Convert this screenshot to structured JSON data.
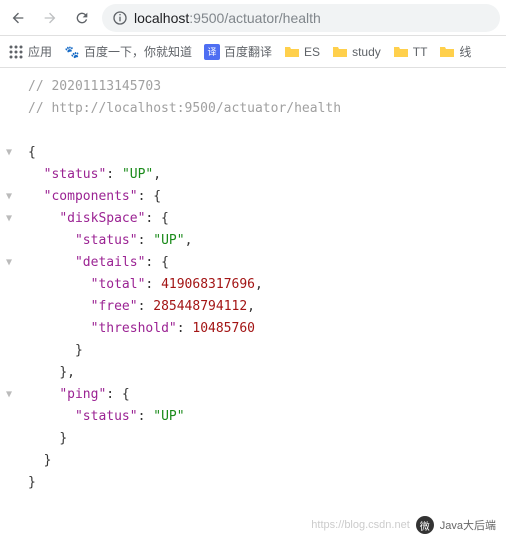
{
  "url": {
    "host": "localhost",
    "port": ":9500",
    "path": "/actuator/health",
    "full": "localhost:9500/actuator/health"
  },
  "bookmarks": {
    "apps": "应用",
    "baidu": "百度一下，你就知道",
    "fanyi": "百度翻译",
    "es": "ES",
    "study": "study",
    "tt": "TT",
    "xian": "线"
  },
  "code": {
    "comment1": "// 20201113145703",
    "comment2": "// http://localhost:9500/actuator/health",
    "k_status": "\"status\"",
    "v_up": "\"UP\"",
    "k_components": "\"components\"",
    "k_diskSpace": "\"diskSpace\"",
    "k_details": "\"details\"",
    "k_total": "\"total\"",
    "v_total": "419068317696",
    "k_free": "\"free\"",
    "v_free": "285448794112",
    "k_threshold": "\"threshold\"",
    "v_threshold": "10485760",
    "k_ping": "\"ping\""
  },
  "watermark": {
    "url": "https://blog.csdn.net",
    "label": "Java大后端"
  }
}
